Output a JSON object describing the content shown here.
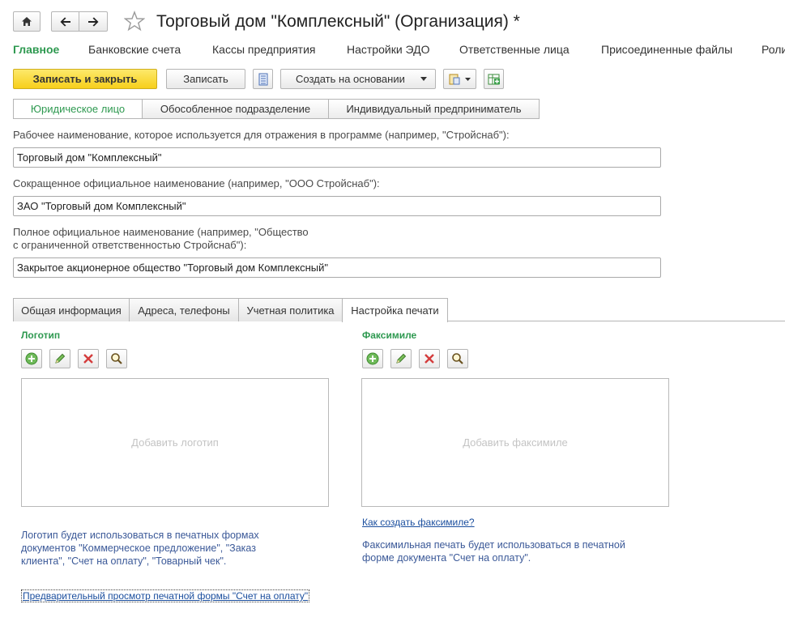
{
  "window": {
    "title": "Торговый дом \"Комплексный\" (Организация) *"
  },
  "sections": [
    {
      "label": "Главное"
    },
    {
      "label": "Банковские счета"
    },
    {
      "label": "Кассы предприятия"
    },
    {
      "label": "Настройки ЭДО"
    },
    {
      "label": "Ответственные лица"
    },
    {
      "label": "Присоединенные файлы"
    },
    {
      "label": "Роли"
    }
  ],
  "toolbar": {
    "save_close": "Записать и закрыть",
    "save": "Записать",
    "create_based": "Создать на основании"
  },
  "org_type": {
    "options": [
      "Юридическое лицо",
      "Обособленное подразделение",
      "Индивидуальный предприниматель"
    ]
  },
  "fields": {
    "work_name_label": "Рабочее наименование, которое используется для отражения в программе (например, \"Стройснаб\"):",
    "work_name_value": "Торговый дом \"Комплексный\"",
    "short_name_label": "Сокращенное официальное наименование (например, \"ООО Стройснаб\"):",
    "short_name_value": "ЗАО \"Торговый дом Комплексный\"",
    "full_name_label_line1": "Полное официальное наименование (например, \"Общество",
    "full_name_label_line2": "с ограниченной ответственностью Стройснаб\"):",
    "full_name_value": "Закрытое акционерное общество \"Торговый дом Комплексный\""
  },
  "tabs": [
    {
      "label": "Общая информация"
    },
    {
      "label": "Адреса, телефоны"
    },
    {
      "label": "Учетная политика"
    },
    {
      "label": "Настройка печати"
    }
  ],
  "logo": {
    "title": "Логотип",
    "placeholder": "Добавить логотип",
    "note_line1": "Логотип будет использоваться в печатных формах",
    "note_line2": "документов \"Коммерческое предложение\", \"Заказ",
    "note_line3": "клиента\", \"Счет на оплату\", \"Товарный чек\".",
    "preview_link": "Предварительный просмотр печатной формы \"Счет на оплату\""
  },
  "facsimile": {
    "title": "Факсимиле",
    "placeholder": "Добавить факсимиле",
    "how_link": "Как создать факсимиле?",
    "note_line1": "Факсимильная печать будет использоваться в печатной",
    "note_line2": "форме документа \"Счет на оплату\"."
  },
  "colors": {
    "accent_green": "#2e9950",
    "primary_yellow": "#f7cf1b",
    "link_blue": "#1a4e9e"
  }
}
